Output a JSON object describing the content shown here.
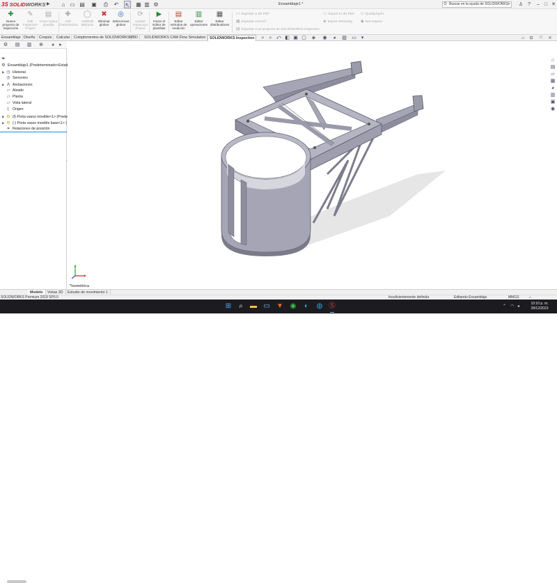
{
  "app": {
    "brand_left": "SOLID",
    "brand_right": "WORKS",
    "document_title": "Ensamblaje1 *",
    "search_placeholder": "Buscar en la ayuda de SOLIDWORKS"
  },
  "ribbon": {
    "buttons": [
      {
        "label": "Nuevo proyecto de inspección",
        "icon": "new-inspection-icon",
        "enabled": true
      },
      {
        "label": "Edit Inspection Project",
        "icon": "edit-project-icon",
        "enabled": false
      },
      {
        "label": "Crear nueva plantilla",
        "icon": "new-template-icon",
        "enabled": false
      },
      {
        "label": "Add Characteristic",
        "icon": "add-characteristic-icon",
        "enabled": false
      },
      {
        "label": "Add/Edit Balloons",
        "icon": "balloons-icon",
        "enabled": false
      },
      {
        "label": "Eliminar globos",
        "icon": "delete-balloons-icon",
        "enabled": true
      },
      {
        "label": "Seleccionar globos",
        "icon": "select-balloons-icon",
        "enabled": true
      },
      {
        "label": "Update Inspection Project",
        "icon": "update-project-icon",
        "enabled": false
      },
      {
        "label": "Iniciar el Editor de plantillas",
        "icon": "template-editor-icon",
        "enabled": true
      },
      {
        "label": "Editar métodos de medición",
        "icon": "measurement-methods-icon",
        "enabled": true
      },
      {
        "label": "Editar operaciones",
        "icon": "operations-icon",
        "enabled": true
      },
      {
        "label": "Editar distribuidores",
        "icon": "vendors-icon",
        "enabled": true
      }
    ],
    "export_items": [
      "Exportar a 2D PDF",
      "Exportar a Excel",
      "Exportar a un proyecto de SOLIDWORKS Inspection"
    ],
    "export_items_2": [
      "Export to 3D PDF",
      "Export eDrawing"
    ],
    "export_items_3": [
      "QualityXpert",
      "Net-Inspect"
    ]
  },
  "tabs": [
    {
      "label": "Ensamblaje",
      "active": false
    },
    {
      "label": "Diseño",
      "active": false
    },
    {
      "label": "Croquis",
      "active": false
    },
    {
      "label": "Calcular",
      "active": false
    },
    {
      "label": "Complementos de SOLIDWORKS",
      "active": false
    },
    {
      "label": "MBD",
      "active": false
    },
    {
      "label": "SOLIDWORKS CAM",
      "active": false
    },
    {
      "label": "Flow Simulation",
      "active": false
    },
    {
      "label": "SOLIDWORKS Inspection",
      "active": true
    }
  ],
  "tree": {
    "root": "Ensamblaje1  (Predeterminado<Estad",
    "items": [
      {
        "label": "Historial",
        "icon": "history-icon",
        "expand": true
      },
      {
        "label": "Sensores",
        "icon": "sensors-icon",
        "expand": false
      },
      {
        "label": "Anotaciones",
        "icon": "annotations-icon",
        "expand": true
      },
      {
        "label": "Alzado",
        "icon": "plane-icon",
        "expand": false
      },
      {
        "label": "Planta",
        "icon": "plane-icon",
        "expand": false
      },
      {
        "label": "Vista lateral",
        "icon": "plane-icon",
        "expand": false
      },
      {
        "label": "Origen",
        "icon": "origin-icon",
        "expand": false
      },
      {
        "label": "(f) Porta vasos movible<1> (Prede",
        "icon": "part-icon",
        "expand": true
      },
      {
        "label": "(-) Porta vasos movible base<1> (",
        "icon": "part-icon",
        "expand": true
      },
      {
        "label": "Relaciones de posición",
        "icon": "mates-icon",
        "expand": false
      }
    ]
  },
  "viewport": {
    "view_label": "*Isométrica"
  },
  "bottom_tabs": [
    {
      "label": "Modelo",
      "active": true
    },
    {
      "label": "Vistas 3D",
      "active": false
    },
    {
      "label": "Estudio de movimiento 1",
      "active": false
    }
  ],
  "status": {
    "version": "SOLIDWORKS Premium 2019 SP0.0",
    "definition": "Insuficientemente definida",
    "mode": "Editando Ensamblaje",
    "units": "MMGS"
  },
  "taskbar": {
    "time": "10:10 p. m.",
    "date": "28/12/2023"
  },
  "colors": {
    "model_fill": "#a5a5b5",
    "model_dark": "#7a7a8a",
    "model_light": "#c9c9d4",
    "shadow": "#e3e3e3",
    "brand_red": "#c8102e"
  }
}
